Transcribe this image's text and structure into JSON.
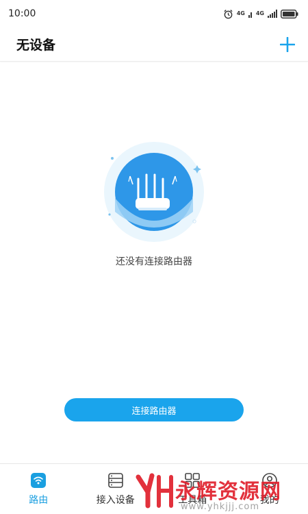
{
  "status_bar": {
    "time": "10:00",
    "network_1": "4G",
    "network_2": "4G"
  },
  "header": {
    "title": "无设备"
  },
  "empty_state": {
    "message": "还没有连接路由器"
  },
  "actions": {
    "connect_label": "连接路由器"
  },
  "tabs": [
    {
      "label": "路由",
      "icon": "wifi-router-icon",
      "active": true
    },
    {
      "label": "接入设备",
      "icon": "device-list-icon",
      "active": false
    },
    {
      "label": "工具箱",
      "icon": "grid-icon",
      "active": false
    },
    {
      "label": "我的",
      "icon": "user-icon",
      "active": false
    }
  ],
  "watermark": {
    "text": "永辉资源网",
    "url": "www.yhkjjj.com"
  },
  "colors": {
    "accent": "#1aa4ec",
    "tab_active": "#1a9fe0",
    "watermark": "#e0202c"
  }
}
